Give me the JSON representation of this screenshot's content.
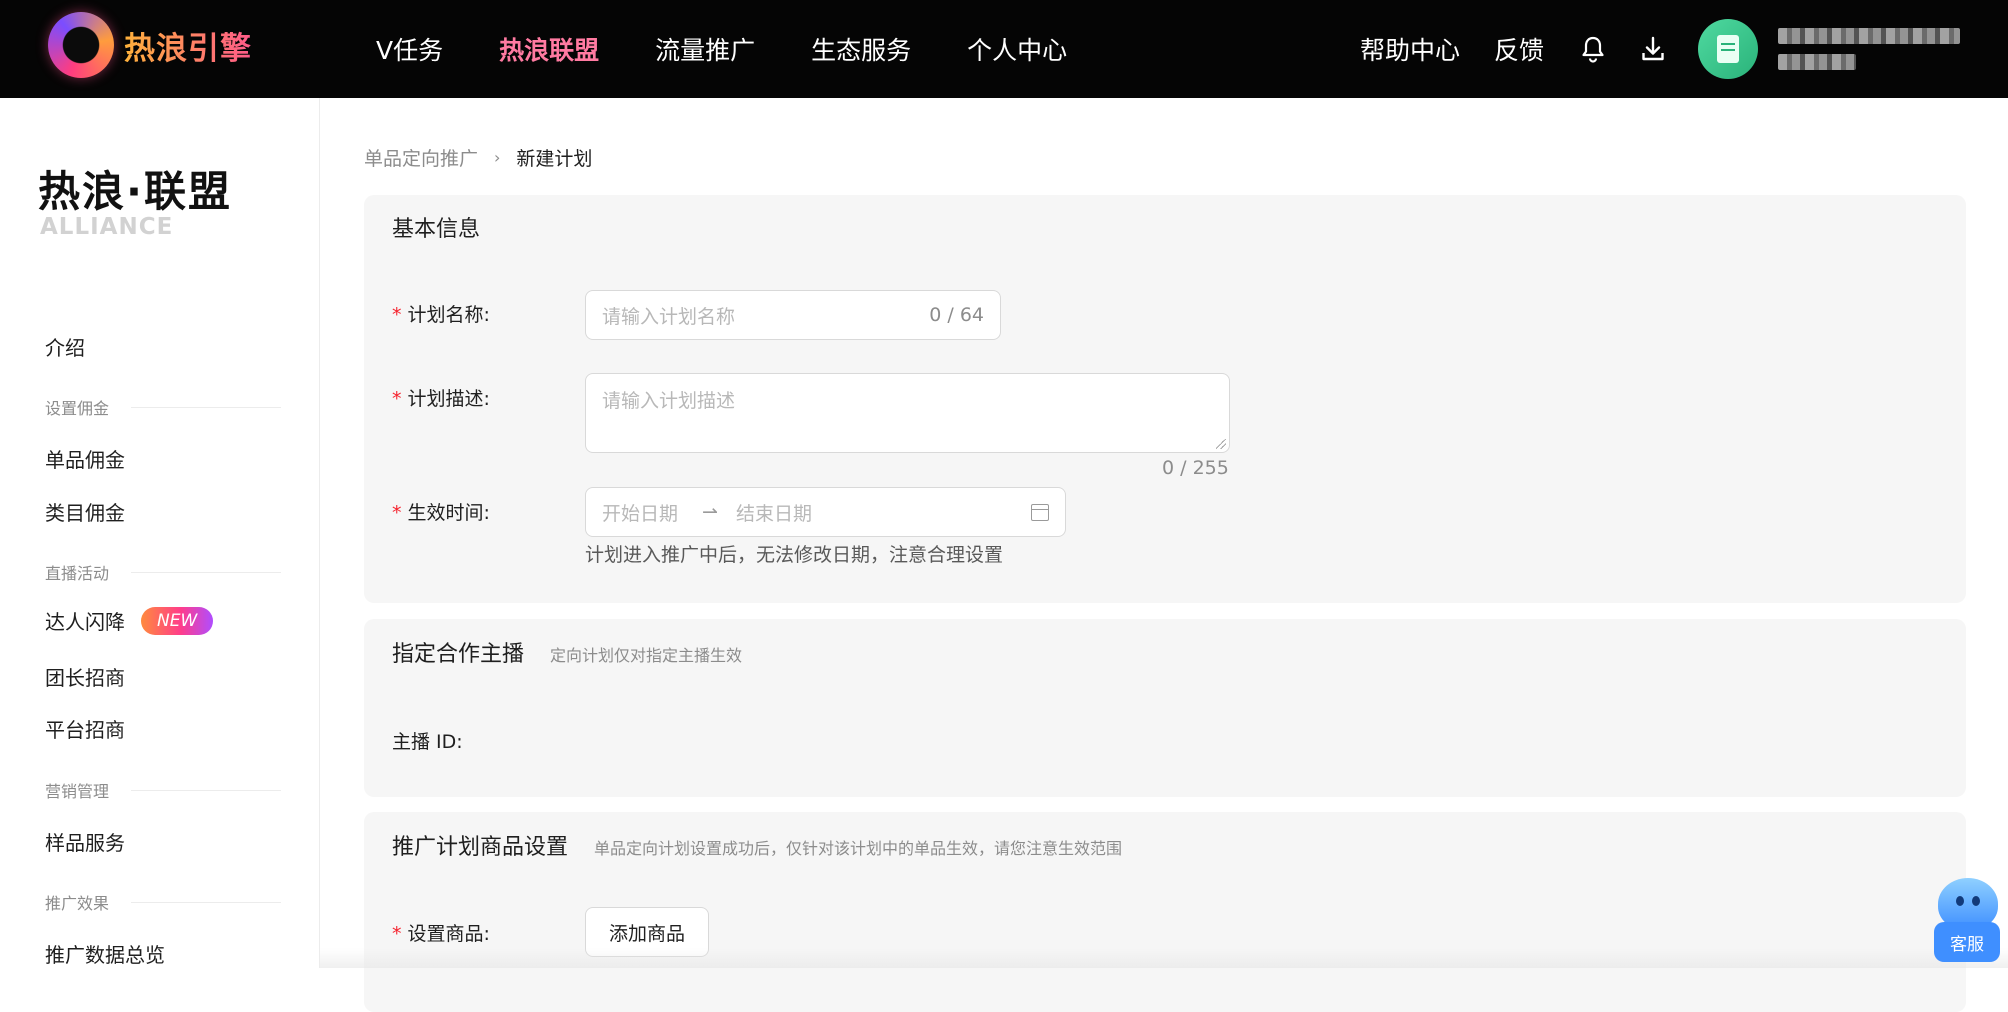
{
  "topnav": {
    "logo_text": "热浪引擎",
    "items": [
      "V任务",
      "热浪联盟",
      "流量推广",
      "生态服务",
      "个人中心"
    ],
    "active_item": "热浪联盟",
    "help": "帮助中心",
    "feedback": "反馈",
    "icons": [
      "bell-icon",
      "download-icon"
    ]
  },
  "sidebar": {
    "brand_cn": "热浪·联盟",
    "brand_en": "ALLIANCE",
    "intro": "介绍",
    "group_commission": "设置佣金",
    "single_commission": "单品佣金",
    "category_commission": "类目佣金",
    "group_live": "直播活动",
    "flash": "达人闪降",
    "new_badge": "NEW",
    "leader": "团长招商",
    "platform": "平台招商",
    "group_marketing": "营销管理",
    "sample": "样品服务",
    "group_effect": "推广效果",
    "overview": "推广数据总览"
  },
  "breadcrumb": {
    "parent": "单品定向推广",
    "separator": "›",
    "current": "新建计划"
  },
  "basic": {
    "title": "基本信息",
    "name_label": "计划名称:",
    "name_placeholder": "请输入计划名称",
    "name_counter": "0 / 64",
    "desc_label": "计划描述:",
    "desc_placeholder": "请输入计划描述",
    "desc_counter": "0 / 255",
    "time_label": "生效时间:",
    "start_placeholder": "开始日期",
    "end_placeholder": "结束日期",
    "time_hint": "计划进入推广中后，无法修改日期，注意合理设置"
  },
  "anchor": {
    "title": "指定合作主播",
    "subtitle": "定向计划仅对指定主播生效",
    "id_label": "主播 ID:"
  },
  "product": {
    "title": "推广计划商品设置",
    "subtitle": "单品定向计划设置成功后，仅针对该计划中的单品生效，请您注意生效范围",
    "label": "设置商品:",
    "add_button": "添加商品"
  },
  "service": {
    "label": "客服"
  },
  "colors": {
    "accent": "#ff7aa1",
    "required": "#f5222d",
    "topbar": "#050505"
  }
}
